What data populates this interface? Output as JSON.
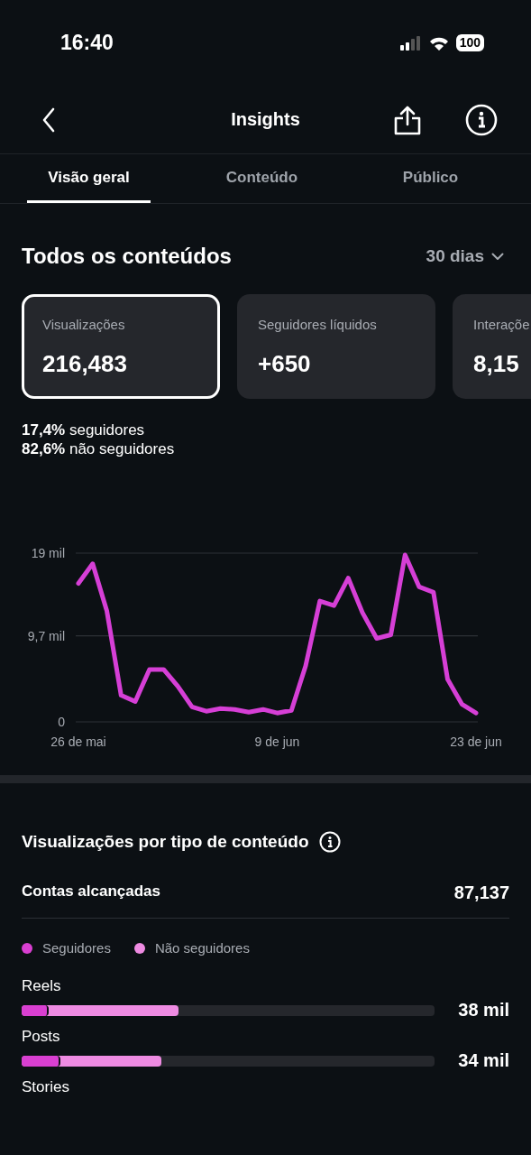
{
  "status_bar": {
    "time": "16:40",
    "battery": "100"
  },
  "nav": {
    "title": "Insights"
  },
  "tabs": [
    {
      "label": "Visão geral",
      "selected": true
    },
    {
      "label": "Conteúdo",
      "selected": false
    },
    {
      "label": "Público",
      "selected": false
    }
  ],
  "section": {
    "title": "Todos os conteúdos",
    "period": "30 dias"
  },
  "cards": [
    {
      "label": "Visualizações",
      "value": "216,483",
      "selected": true
    },
    {
      "label": "Seguidores líquidos",
      "value": "+650",
      "selected": false
    },
    {
      "label": "Interaçõe",
      "value": "8,15",
      "selected": false
    }
  ],
  "split": [
    {
      "percent": "17,4%",
      "label": "seguidores"
    },
    {
      "percent": "82,6%",
      "label": "não seguidores"
    }
  ],
  "chart_data": {
    "type": "line",
    "categories": [
      "26 de mai",
      null,
      null,
      null,
      null,
      null,
      null,
      null,
      null,
      null,
      null,
      null,
      null,
      null,
      "9 de jun",
      null,
      null,
      null,
      null,
      null,
      null,
      null,
      null,
      null,
      null,
      null,
      null,
      null,
      "23 de jun"
    ],
    "series": [
      {
        "color": "#d63fd6",
        "values": [
          15.6,
          17.8,
          12.5,
          3.0,
          2.3,
          5.9,
          5.9,
          4.0,
          1.7,
          1.2,
          1.5,
          1.4,
          1.1,
          1.4,
          1.0,
          1.3,
          6.3,
          13.6,
          13.1,
          16.2,
          12.3,
          9.4,
          9.8,
          18.8,
          15.2,
          14.6,
          4.8,
          2.0,
          1.0
        ]
      }
    ],
    "ylim": [
      0,
      19
    ],
    "yticks": [
      {
        "value": 0,
        "label": "0"
      },
      {
        "value": 9.7,
        "label": "9,7 mil"
      },
      {
        "value": 19,
        "label": "19 mil"
      }
    ]
  },
  "breakdown": {
    "title": "Visualizações por tipo de conteúdo",
    "reach_label": "Contas alcançadas",
    "reach_value": "87,137",
    "legend": [
      {
        "label": "Seguidores",
        "color": "#d93fd1"
      },
      {
        "label": "Não seguidores",
        "color": "#ee8be2"
      }
    ],
    "rows": [
      {
        "label": "Reels",
        "value": "38 mil",
        "segments": [
          {
            "level": 0.066
          },
          {
            "level": 0.38
          }
        ]
      },
      {
        "label": "Posts",
        "value": "34 mil",
        "segments": [
          {
            "level": 0.094
          },
          {
            "level": 0.338
          }
        ]
      },
      {
        "label": "Stories"
      }
    ]
  }
}
